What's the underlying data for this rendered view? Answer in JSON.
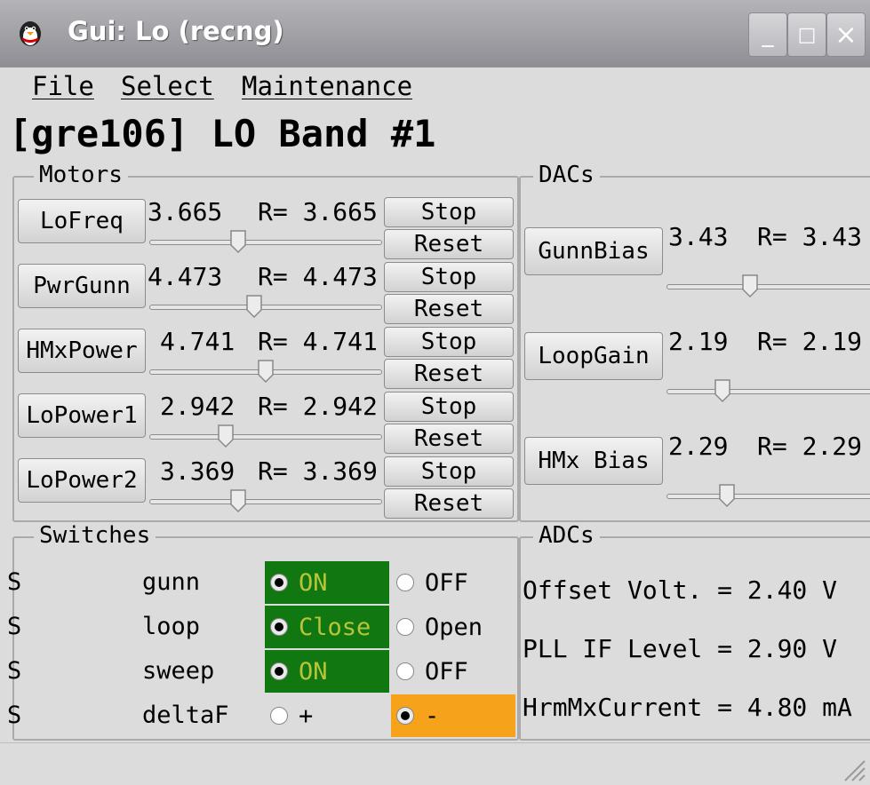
{
  "window": {
    "title": "Gui: Lo (recng)",
    "buttons": {
      "minimize": "_",
      "maximize": "□",
      "close": "×"
    }
  },
  "menu": {
    "file": "File",
    "select": "Select",
    "maintenance": "Maintenance"
  },
  "heading": "[gre106] LO Band #1",
  "motors": {
    "label": "Motors",
    "stop_label": "Stop",
    "reset_label": "Reset",
    "items": [
      {
        "name": "LoFreq",
        "value": "3.665",
        "readback": "R= 3.665",
        "level": 0.38
      },
      {
        "name": "PwrGunn",
        "value": "4.473",
        "readback": "R= 4.473",
        "level": 0.45
      },
      {
        "name": "HMxPower",
        "value": "4.741",
        "readback": "R= 4.741",
        "level": 0.5
      },
      {
        "name": "LoPower1",
        "value": "2.942",
        "readback": "R= 2.942",
        "level": 0.33
      },
      {
        "name": "LoPower2",
        "value": "3.369",
        "readback": "R= 3.369",
        "level": 0.38
      }
    ]
  },
  "dacs": {
    "label": "DACs",
    "items": [
      {
        "name": "GunnBias",
        "value": "3.43",
        "readback": "R= 3.43",
        "level": 0.35
      },
      {
        "name": "LoopGain",
        "value": "2.19",
        "readback": "R= 2.19",
        "level": 0.22
      },
      {
        "name": "HMx Bias",
        "value": "2.29",
        "readback": "R= 2.29",
        "level": 0.24
      }
    ]
  },
  "switches": {
    "label": "Switches",
    "rows": [
      {
        "s": "S",
        "name": "gunn",
        "opt1": "ON",
        "opt2": "OFF",
        "selected": 1
      },
      {
        "s": "S",
        "name": "loop",
        "opt1": "Close",
        "opt2": "Open",
        "selected": 1
      },
      {
        "s": "S",
        "name": "sweep",
        "opt1": "ON",
        "opt2": "OFF",
        "selected": 1
      },
      {
        "s": "S",
        "name": "deltaF",
        "opt1": "+",
        "opt2": "-",
        "selected": 2
      }
    ],
    "colors": {
      "on": "#117711",
      "on_text": "#b8c43a",
      "warn": "#f6a21a"
    }
  },
  "adcs": {
    "label": "ADCs",
    "items": [
      {
        "text": "Offset Volt. = 2.40 V"
      },
      {
        "text": "PLL IF Level = 2.90 V"
      },
      {
        "text": "HrmMxCurrent = 4.80 mA"
      }
    ]
  }
}
